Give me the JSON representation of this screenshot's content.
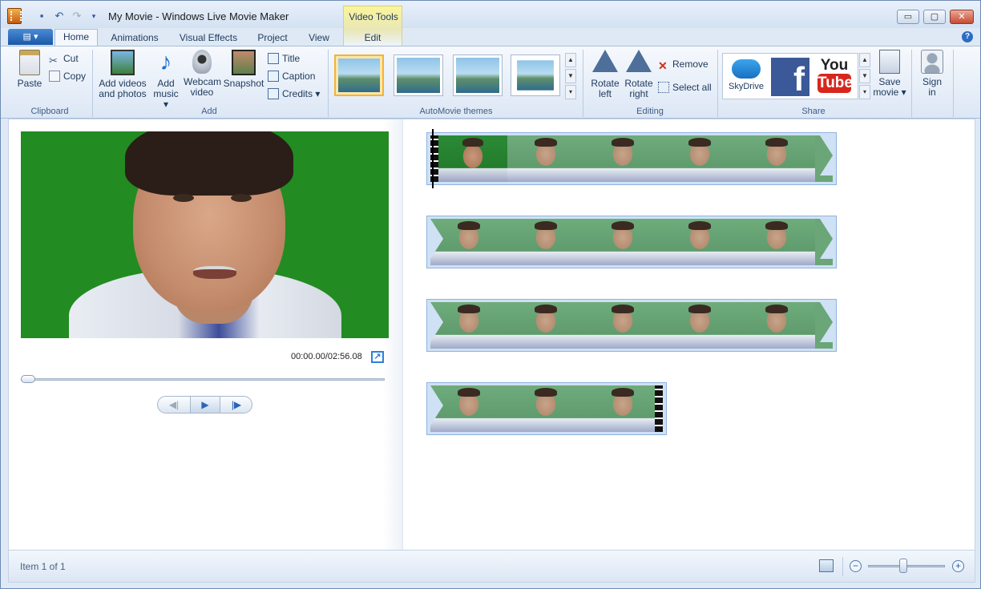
{
  "window": {
    "title": "My Movie - Windows Live Movie Maker",
    "contextual_group": "Video Tools",
    "controls": {
      "minimize": "▭",
      "maximize": "▢",
      "close": "✕"
    }
  },
  "tabs": {
    "app_menu": "▤ ▾",
    "items": [
      "Home",
      "Animations",
      "Visual Effects",
      "Project",
      "View",
      "Edit"
    ],
    "active": "Home",
    "help": "?"
  },
  "ribbon": {
    "clipboard": {
      "label": "Clipboard",
      "paste": "Paste",
      "cut": "Cut",
      "copy": "Copy"
    },
    "add": {
      "label": "Add",
      "add_videos_line1": "Add videos",
      "add_videos_line2": "and photos",
      "add_music_line1": "Add",
      "add_music_line2": "music ▾",
      "webcam_line1": "Webcam",
      "webcam_line2": "video",
      "snapshot": "Snapshot",
      "title": "Title",
      "caption": "Caption",
      "credits": "Credits ▾"
    },
    "themes": {
      "label": "AutoMovie themes",
      "selected_index": 0
    },
    "editing": {
      "label": "Editing",
      "rotate_left_line1": "Rotate",
      "rotate_left_line2": "left",
      "rotate_right_line1": "Rotate",
      "rotate_right_line2": "right",
      "remove": "Remove",
      "select_all": "Select all"
    },
    "share": {
      "label": "Share",
      "skydrive": "SkyDrive",
      "facebook": "f",
      "youtube_line1": "You",
      "youtube_line2": "Tube",
      "save_movie_line1": "Save",
      "save_movie_line2": "movie ▾"
    },
    "signin": {
      "line1": "Sign",
      "line2": "in"
    }
  },
  "preview": {
    "time": "00:00.00/02:56.08",
    "seek_position": 0,
    "controls": {
      "prev_frame": "◀|",
      "play": "▶",
      "next_frame": "|▶"
    }
  },
  "storyboard": {
    "clips": [
      {
        "frames": 5,
        "start": true,
        "end": false
      },
      {
        "frames": 5,
        "start": false,
        "end": false
      },
      {
        "frames": 5,
        "start": false,
        "end": false
      },
      {
        "frames": 3,
        "start": false,
        "end": true
      }
    ]
  },
  "status": {
    "text": "Item 1 of 1",
    "zoom_level": 0.45,
    "zoom_out": "−",
    "zoom_in": "+"
  },
  "colors": {
    "ribbon_bg": "#dce7f5",
    "accent": "#1c58a8",
    "green_screen": "#228b22",
    "theme_highlight": "#f2b33a"
  }
}
